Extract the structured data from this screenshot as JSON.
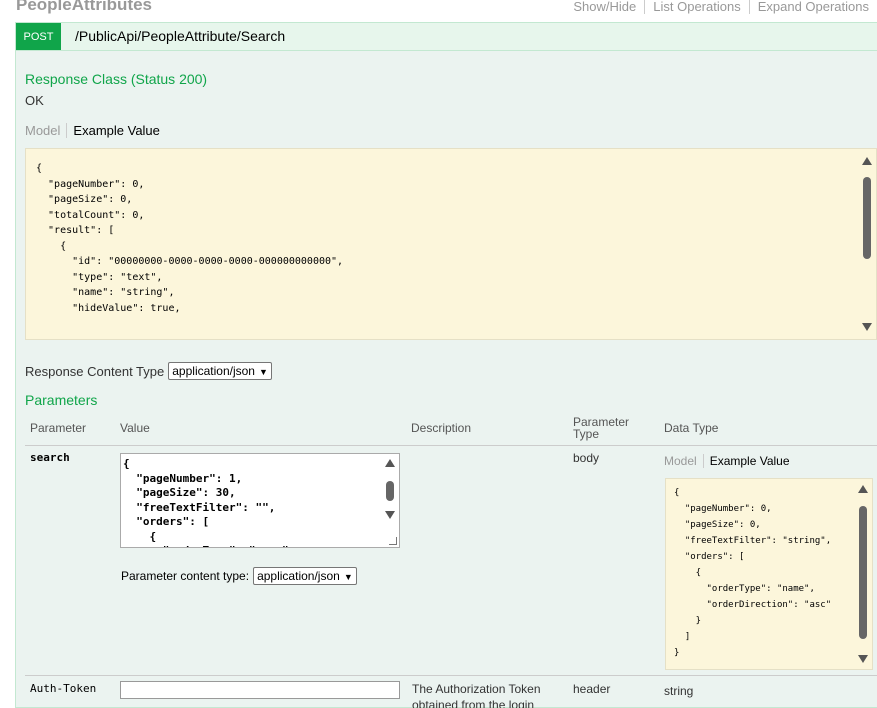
{
  "header": {
    "section_title": "PeopleAttributes",
    "links": [
      "Show/Hide",
      "List Operations",
      "Expand Operations"
    ]
  },
  "operation": {
    "method": "POST",
    "path": "/PublicApi/PeopleAttribute/Search"
  },
  "response": {
    "class_title": "Response Class (Status 200)",
    "status_text": "OK",
    "tabs": {
      "model": "Model",
      "example": "Example Value"
    },
    "example_json": "{\n  \"pageNumber\": 0,\n  \"pageSize\": 0,\n  \"totalCount\": 0,\n  \"result\": [\n    {\n      \"id\": \"00000000-0000-0000-0000-000000000000\",\n      \"type\": \"text\",\n      \"name\": \"string\",\n      \"hideValue\": true,",
    "content_type_label": "Response Content Type",
    "content_type_value": "application/json"
  },
  "parameters": {
    "title": "Parameters",
    "columns": {
      "parameter": "Parameter",
      "value": "Value",
      "description": "Description",
      "parameter_type": "Parameter\nType",
      "data_type": "Data Type"
    },
    "rows": [
      {
        "name": "search",
        "value_text": "{\n  \"pageNumber\": 1,\n  \"pageSize\": 30,\n  \"freeTextFilter\": \"\",\n  \"orders\": [\n    {\n      \"orderType\": \"name\",",
        "content_type_label": "Parameter content type:",
        "content_type_value": "application/json",
        "description": "",
        "parameter_type": "body",
        "data_type_tabs": {
          "model": "Model",
          "example": "Example Value"
        },
        "data_type_json": "{\n  \"pageNumber\": 0,\n  \"pageSize\": 0,\n  \"freeTextFilter\": \"string\",\n  \"orders\": [\n    {\n      \"orderType\": \"name\",\n      \"orderDirection\": \"asc\"\n    }\n  ]\n}"
      },
      {
        "name": "Auth-Token",
        "value_text": "",
        "description": "The Authorization Token obtained from the login",
        "parameter_type": "header",
        "data_type": "string"
      }
    ]
  }
}
